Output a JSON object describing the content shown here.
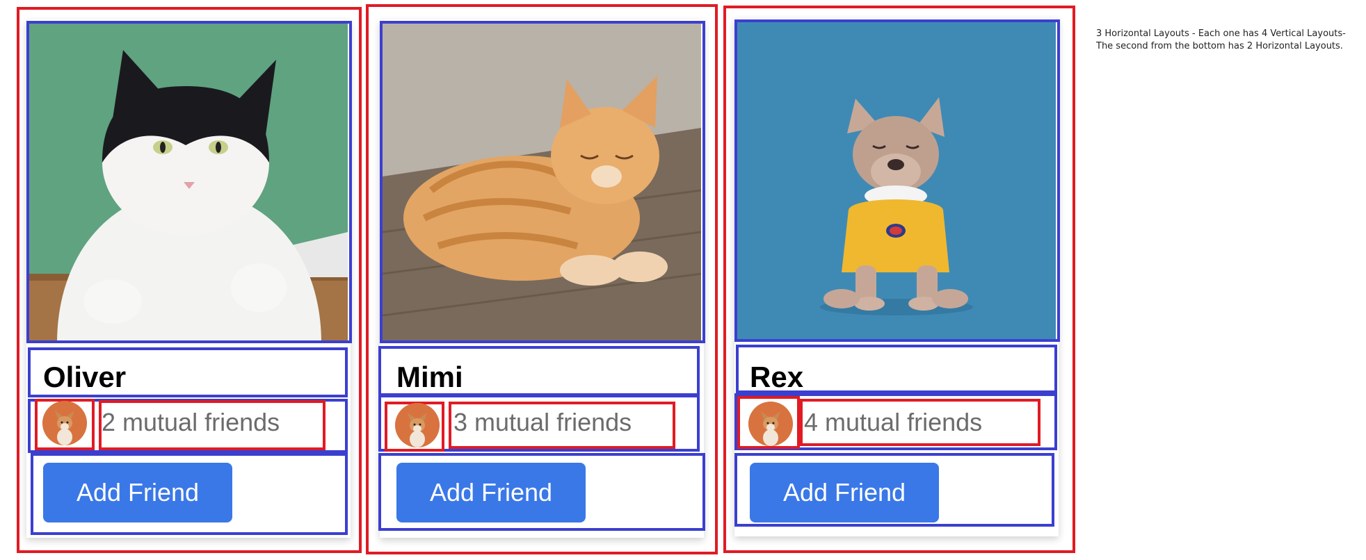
{
  "colors": {
    "layout_red": "#e01b24",
    "layout_blue": "#3b3fcf",
    "button_blue": "#3a78e8",
    "mutual_text": "#6b6b6b"
  },
  "annotation": {
    "text": "3 Horizontal Layouts - Each one has 4 Vertical Layouts- The second from the bottom has 2 Horizontal Layouts."
  },
  "cards": [
    {
      "name": "Oliver",
      "mutual_friends": "2 mutual friends",
      "button_label": "Add Friend",
      "photo": "black-and-white-cat-photo",
      "avatar": "corgi-avatar"
    },
    {
      "name": "Mimi",
      "mutual_friends": "3 mutual friends",
      "button_label": "Add Friend",
      "photo": "orange-tabby-cat-photo",
      "avatar": "corgi-avatar"
    },
    {
      "name": "Rex",
      "mutual_friends": "4 mutual friends",
      "button_label": "Add Friend",
      "photo": "french-bulldog-photo",
      "avatar": "corgi-avatar"
    }
  ]
}
